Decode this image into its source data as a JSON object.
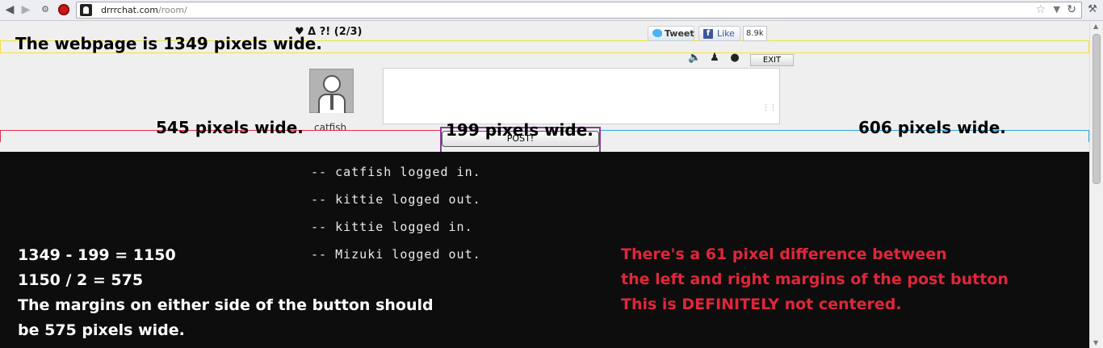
{
  "browser": {
    "url_host": "drrrchat.com",
    "url_path": "/room/"
  },
  "room": {
    "title": "♥ Δ ?! (2/3)"
  },
  "social": {
    "tweet_label": "Tweet",
    "like_label": "Like",
    "like_count": "8.9k"
  },
  "toolbar": {
    "exit_label": "EXIT"
  },
  "user": {
    "name": "catfish"
  },
  "composer": {
    "message": "",
    "post_label": "POST!"
  },
  "log": [
    "-- catfish logged in.",
    "-- kittie logged out.",
    "-- kittie logged in.",
    "-- Mizuki logged out."
  ],
  "annotations": {
    "webpage_width": "The webpage is 1349 pixels wide.",
    "left_margin": "545 pixels wide.",
    "button_width": "199 pixels wide.",
    "right_margin": "606 pixels wide.",
    "math": [
      "1349 - 199 = 1150",
      "1150 / 2 = 575",
      "The margins on either side of the button should",
      "be 575 pixels wide."
    ],
    "conclusion": [
      "There's a 61 pixel difference between",
      "the left and right margins of the post button",
      "This is DEFINITELY not centered."
    ]
  },
  "colors": {
    "annotation_red": "#e0263a",
    "left_margin_line": "#e0314b",
    "right_margin_line": "#2ea3dc",
    "button_outline": "#8b3a9e",
    "yellow_guide": "#f0e23d"
  }
}
